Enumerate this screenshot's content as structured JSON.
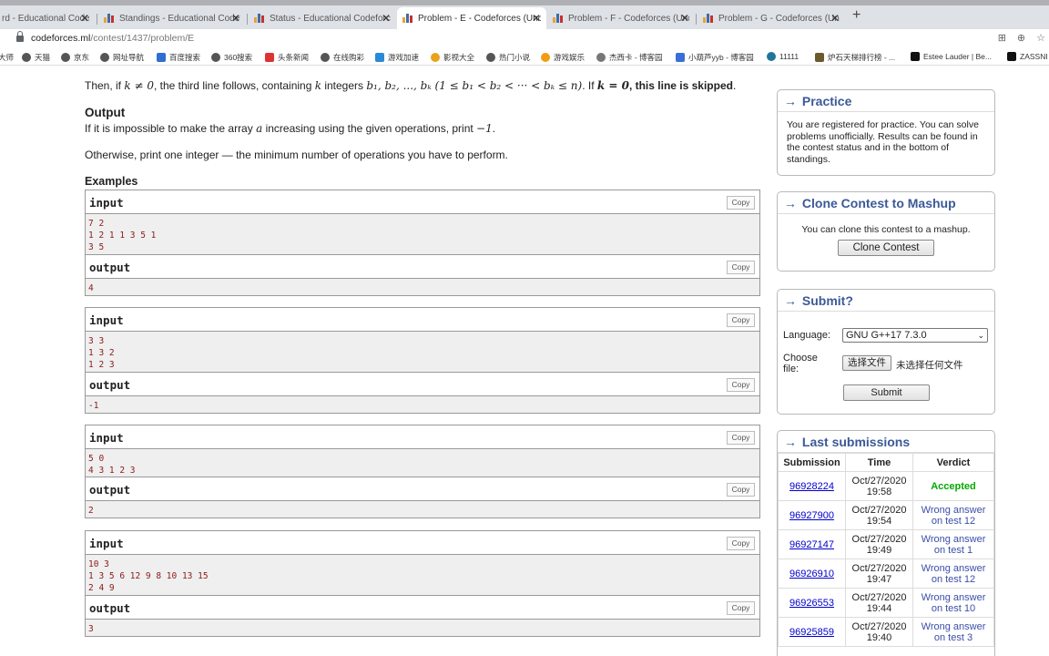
{
  "browser": {
    "tabs": [
      {
        "title": "rd - Educational Code",
        "active": false
      },
      {
        "title": "Standings - Educational Codef",
        "active": false
      },
      {
        "title": "Status - Educational Codeforc",
        "active": false
      },
      {
        "title": "Problem - E - Codeforces (Unc",
        "active": true
      },
      {
        "title": "Problem - F - Codeforces (Unc",
        "active": false
      },
      {
        "title": "Problem - G - Codeforces (Unc",
        "active": false
      }
    ],
    "url_host": "codeforces.ml",
    "url_path": "/contest/1437/problem/E",
    "bookmarks": [
      "大师",
      "天猫",
      "京东",
      "网址导航",
      "百度搜索",
      "360搜索",
      "头条新闻",
      "在线购彩",
      "游戏加速",
      "影视大全",
      "热门小说",
      "游戏娱乐",
      "杰西卡 - 博客园",
      "小葫芦yyb - 博客园",
      "11111",
      "炉石天梯排行榜 - ...",
      "Estee Lauder | Be...",
      "ZASSNI"
    ]
  },
  "statement": {
    "line1_a": "Then, if ",
    "line1_b": "k ≠ 0",
    "line1_c": ", the third line follows, containing ",
    "line1_d": "k",
    "line1_e": " integers ",
    "line1_f": "b₁, b₂, ..., bₖ (1 ≤ b₁ < b₂ < ··· < bₖ ≤ n)",
    "line1_g": ". If ",
    "line1_h": "k = 0",
    "line1_i": ", this line is skipped",
    "line1_j": ".",
    "output_title": "Output",
    "output_a": "If it is impossible to make the array ",
    "output_b": "a",
    "output_c": " increasing using the given operations, print ",
    "output_d": "−1",
    "output_e": ".",
    "output_p2": "Otherwise, print one integer — the minimum number of operations you have to perform.",
    "examples_title": "Examples"
  },
  "examples": [
    {
      "input_label": "input",
      "input": "7 2\n1 2 1 1 3 5 1\n3 5",
      "output_label": "output",
      "output": "4",
      "copy": "Copy"
    },
    {
      "input_label": "input",
      "input": "3 3\n1 3 2\n1 2 3",
      "output_label": "output",
      "output": "-1",
      "copy": "Copy"
    },
    {
      "input_label": "input",
      "input": "5 0\n4 3 1 2 3",
      "output_label": "output",
      "output": "2",
      "copy": "Copy"
    },
    {
      "input_label": "input",
      "input": "10 3\n1 3 5 6 12 9 8 10 13 15\n2 4 9",
      "output_label": "output",
      "output": "3",
      "copy": "Copy"
    }
  ],
  "sidebar": {
    "arrow": "→",
    "practice": {
      "title": "Practice",
      "text": "You are registered for practice. You can solve problems unofficially. Results can be found in the contest status and in the bottom of standings."
    },
    "clone": {
      "title": "Clone Contest to Mashup",
      "text": "You can clone this contest to a mashup.",
      "button": "Clone Contest"
    },
    "submit": {
      "title": "Submit?",
      "language_label": "Language:",
      "language_value": "GNU G++17 7.3.0",
      "file_label": "Choose file:",
      "file_button": "选择文件",
      "file_status": "未选择任何文件",
      "submit_button": "Submit"
    },
    "last": {
      "title": "Last submissions",
      "headers": [
        "Submission",
        "Time",
        "Verdict"
      ],
      "rows": [
        {
          "id": "96928224",
          "date": "Oct/27/2020",
          "time": "19:58",
          "v1": "Accepted",
          "v2": "",
          "ok": true
        },
        {
          "id": "96927900",
          "date": "Oct/27/2020",
          "time": "19:54",
          "v1": "Wrong answer",
          "v2": "on test 12",
          "ok": false
        },
        {
          "id": "96927147",
          "date": "Oct/27/2020",
          "time": "19:49",
          "v1": "Wrong answer",
          "v2": "on test 1",
          "ok": false
        },
        {
          "id": "96926910",
          "date": "Oct/27/2020",
          "time": "19:47",
          "v1": "Wrong answer",
          "v2": "on test 12",
          "ok": false
        },
        {
          "id": "96926553",
          "date": "Oct/27/2020",
          "time": "19:44",
          "v1": "Wrong answer",
          "v2": "on test 10",
          "ok": false
        },
        {
          "id": "96925859",
          "date": "Oct/27/2020",
          "time": "19:40",
          "v1": "Wrong answer",
          "v2": "on test 3",
          "ok": false
        }
      ]
    }
  }
}
